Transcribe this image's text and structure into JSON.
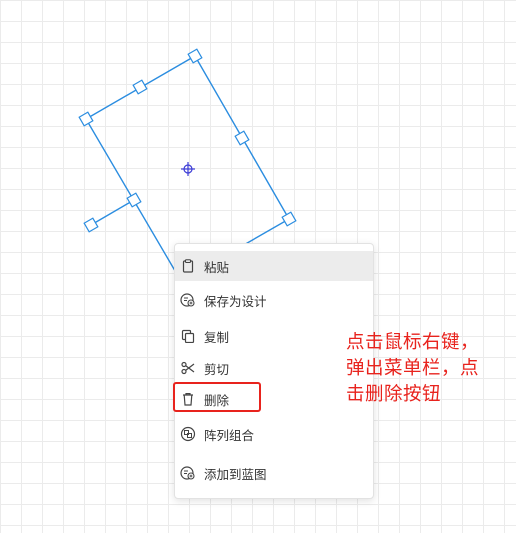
{
  "context_menu": {
    "items": [
      {
        "label": "粘贴",
        "icon": "clipboard-icon"
      },
      {
        "label": "保存为设计",
        "icon": "save-design-icon"
      },
      {
        "label": "复制",
        "icon": "copy-icon"
      },
      {
        "label": "剪切",
        "icon": "scissors-icon"
      },
      {
        "label": "删除",
        "icon": "trash-icon"
      },
      {
        "label": "阵列组合",
        "icon": "array-group-icon"
      },
      {
        "label": "添加到蓝图",
        "icon": "add-blueprint-icon"
      }
    ]
  },
  "annotation": {
    "lines": [
      "点击鼠标右键，",
      "弹出菜单栏，点",
      "击删除按钮"
    ],
    "color": "#e8231d"
  },
  "selection": {
    "stroke_color": "#2b8de0",
    "center_color": "#3b3bd6"
  }
}
